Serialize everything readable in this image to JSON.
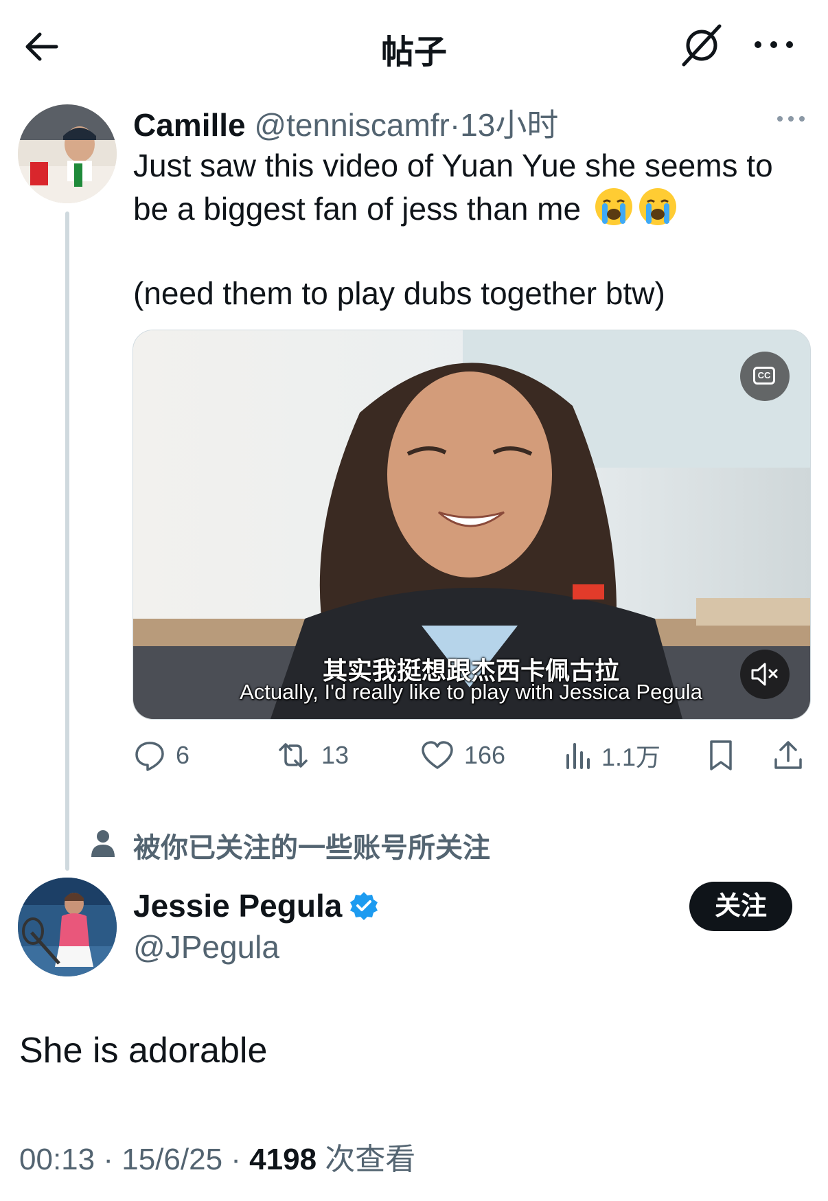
{
  "header": {
    "title": "帖子",
    "back_icon": "arrow-left-icon",
    "grok_icon": "grok-icon",
    "more_icon": "more-horizontal-icon"
  },
  "tweet1": {
    "author_name": "Camille",
    "handle": "@tenniscamfr",
    "separator": "·",
    "time": "13小时",
    "text_line1": "Just saw this video of Yuan Yue she seems to be a biggest fan of jess than me",
    "emoji": "loudly-crying-face",
    "text_line2": "(need them to play dubs together btw)",
    "video": {
      "subtitle_cn": "其实我挺想跟杰西卡佩古拉",
      "subtitle_en": "Actually, I'd really like to play with Jessica Pegula",
      "cc_label": "CC"
    },
    "actions": {
      "replies": "6",
      "retweets": "13",
      "likes": "166",
      "views": "1.1万"
    }
  },
  "followed_note": "被你已关注的一些账号所关注",
  "tweet2": {
    "author_name": "Jessie Pegula",
    "handle": "@JPegula",
    "follow_label": "关注",
    "text": "She is adorable",
    "time": "00:13",
    "date": "15/6/25",
    "views_count": "4198",
    "views_label": "次查看",
    "separator": "·"
  },
  "colors": {
    "text_primary": "#0f1419",
    "text_secondary": "#536471",
    "verified_blue": "#1d9bf0",
    "thread_line": "#cfd9de"
  }
}
